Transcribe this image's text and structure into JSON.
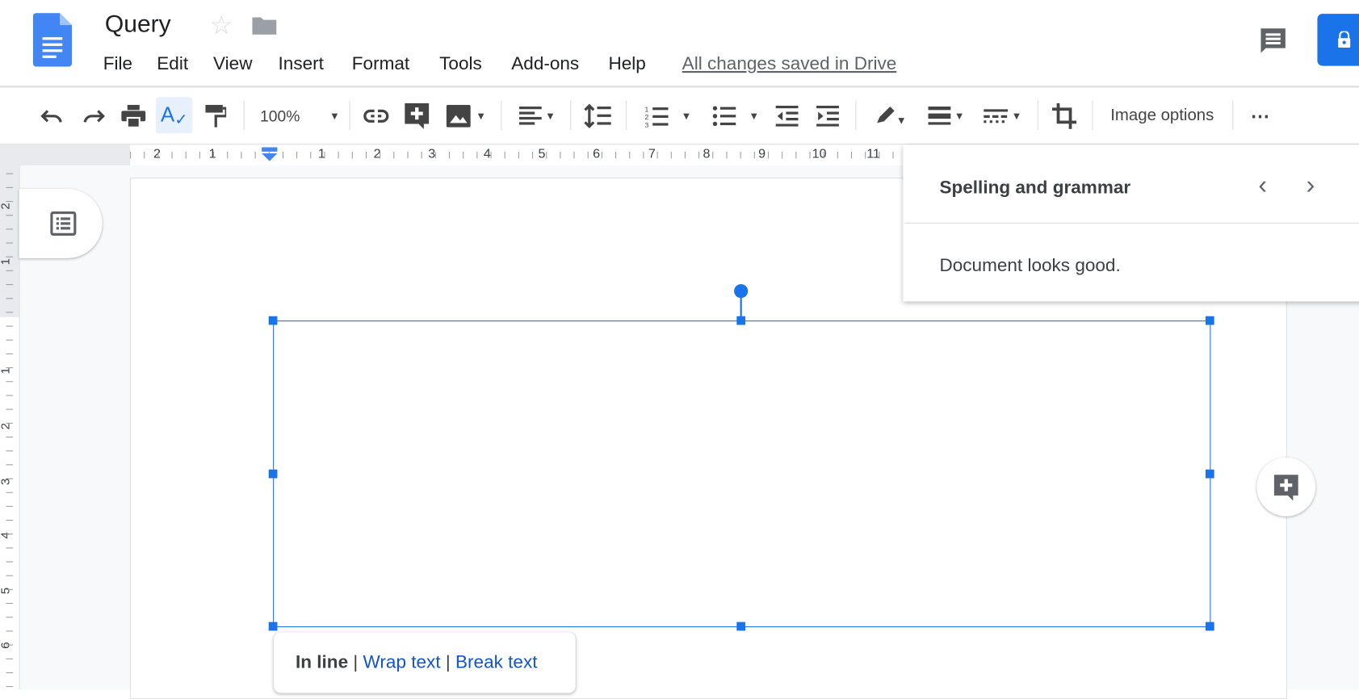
{
  "app": {
    "title": "Query",
    "save_status": "All changes saved in Drive"
  },
  "menu": [
    "File",
    "Edit",
    "View",
    "Insert",
    "Format",
    "Tools",
    "Add-ons",
    "Help"
  ],
  "toolbar": {
    "zoom": "100%",
    "image_options": "Image options",
    "more": "⋯"
  },
  "ruler": {
    "horizontal": [
      "2",
      "1",
      "1",
      "2",
      "3",
      "4",
      "5",
      "6",
      "7",
      "8",
      "9",
      "10",
      "11"
    ],
    "vertical": [
      "2",
      "1",
      "1",
      "2",
      "3",
      "4",
      "5",
      "6"
    ]
  },
  "spelling_panel": {
    "title": "Spelling and grammar",
    "message": "Document looks good."
  },
  "image_popup": {
    "inline": "In line",
    "sep": "|",
    "wrap": "Wrap text",
    "break": "Break text"
  },
  "colors": {
    "accent": "#1a73e8",
    "docs_blue": "#4285f4"
  }
}
